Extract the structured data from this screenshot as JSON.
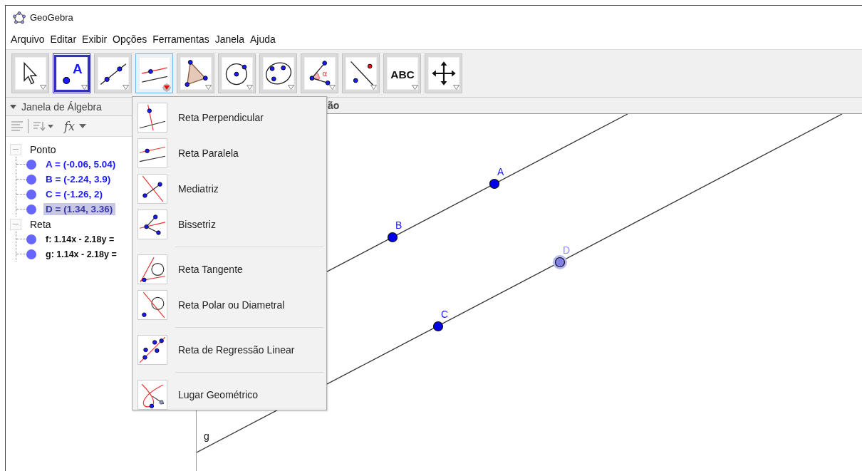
{
  "window": {
    "title": "GeoGebra"
  },
  "menu_bar": [
    "Arquivo",
    "Editar",
    "Exibir",
    "Opções",
    "Ferramentas",
    "Janela",
    "Ajuda"
  ],
  "toolbar": [
    {
      "kind": "move",
      "selected": false,
      "open": false
    },
    {
      "kind": "point",
      "label": "A",
      "selected": true,
      "open": false
    },
    {
      "kind": "line",
      "selected": false,
      "open": false
    },
    {
      "kind": "parallel",
      "selected": false,
      "open": true
    },
    {
      "kind": "polygon",
      "selected": false,
      "open": false
    },
    {
      "kind": "circle",
      "selected": false,
      "open": false
    },
    {
      "kind": "conic",
      "selected": false,
      "open": false
    },
    {
      "kind": "angle",
      "label": "α",
      "selected": false,
      "open": false
    },
    {
      "kind": "reflect",
      "selected": false,
      "open": false
    },
    {
      "kind": "text",
      "label": "ABC",
      "selected": false,
      "open": false
    },
    {
      "kind": "move_view",
      "selected": false,
      "open": false
    }
  ],
  "algebra": {
    "title": "Janela de Álgebra",
    "function_button": "fx",
    "groups": [
      {
        "label": "Ponto",
        "kind": "point",
        "expanded": true,
        "children": [
          {
            "text": "A = (-0.06, 5.04)",
            "selected": false
          },
          {
            "text": "B = (-2.24, 3.9)",
            "selected": false
          },
          {
            "text": "C = (-1.26, 2)",
            "selected": false
          },
          {
            "text": "D = (1.34, 3.36)",
            "selected": true
          }
        ]
      },
      {
        "label": "Reta",
        "kind": "line",
        "expanded": true,
        "children": [
          {
            "text": "f: 1.14x - 2.18y =",
            "selected": false
          },
          {
            "text": "g: 1.14x - 2.18y =",
            "selected": false
          }
        ]
      }
    ]
  },
  "graphics": {
    "title": "ão",
    "lines": [
      {
        "kind": "line"
      },
      {
        "kind": "line",
        "label": "g"
      }
    ],
    "points": [
      {
        "label": "A",
        "selected": false
      },
      {
        "label": "B",
        "selected": false
      },
      {
        "label": "C",
        "selected": false
      },
      {
        "label": "D",
        "selected": true
      }
    ]
  },
  "tool_menu": {
    "groups": [
      [
        {
          "kind": "perpendicular",
          "label": "Reta Perpendicular"
        },
        {
          "kind": "parallel",
          "label": "Reta Paralela"
        },
        {
          "kind": "bisector_perp",
          "label": "Mediatriz"
        },
        {
          "kind": "angle_bisector",
          "label": "Bissetriz"
        }
      ],
      [
        {
          "kind": "tangent",
          "label": "Reta Tangente"
        },
        {
          "kind": "polar",
          "label": "Reta Polar ou Diametral"
        }
      ],
      [
        {
          "kind": "regression",
          "label": "Reta de Regressão Linear"
        }
      ],
      [
        {
          "kind": "locus",
          "label": "Lugar Geométrico"
        }
      ]
    ]
  }
}
